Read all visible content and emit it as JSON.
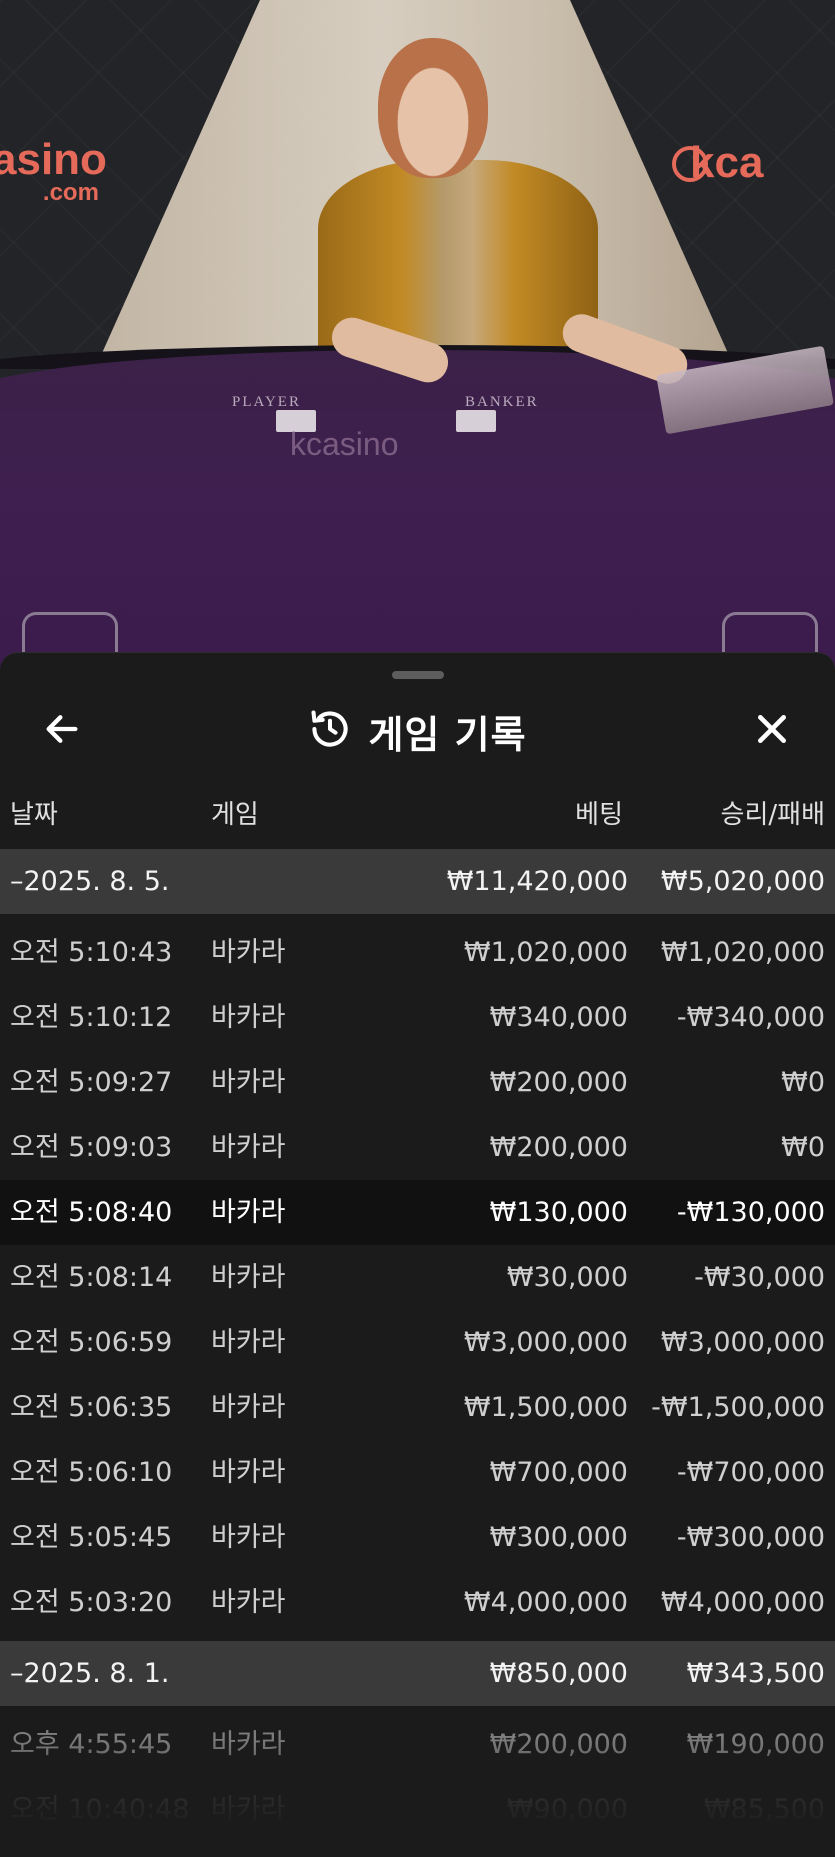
{
  "video": {
    "logo_left": "asino",
    "logo_left_sub": ".com",
    "logo_right": "kca",
    "table_player": "PLAYER",
    "table_banker": "BANKER",
    "table_logo": "kcasino"
  },
  "header": {
    "title": "게임 기록",
    "back_icon": "arrow-left-icon",
    "history_icon": "history-icon",
    "close_icon": "close-icon"
  },
  "columns": {
    "date": "날짜",
    "game": "게임",
    "bet": "베팅",
    "result": "승리/패배"
  },
  "groups": [
    {
      "date": "–2025. 8. 5.",
      "bet_total": "₩11,420,000",
      "result_total": "₩5,020,000",
      "rows": [
        {
          "time": "오전 5:10:43",
          "game": "바카라",
          "bet": "₩1,020,000",
          "result": "₩1,020,000"
        },
        {
          "time": "오전 5:10:12",
          "game": "바카라",
          "bet": "₩340,000",
          "result": "-₩340,000"
        },
        {
          "time": "오전 5:09:27",
          "game": "바카라",
          "bet": "₩200,000",
          "result": "₩0"
        },
        {
          "time": "오전 5:09:03",
          "game": "바카라",
          "bet": "₩200,000",
          "result": "₩0"
        },
        {
          "time": "오전 5:08:40",
          "game": "바카라",
          "bet": "₩130,000",
          "result": "-₩130,000"
        },
        {
          "time": "오전 5:08:14",
          "game": "바카라",
          "bet": "₩30,000",
          "result": "-₩30,000"
        },
        {
          "time": "오전 5:06:59",
          "game": "바카라",
          "bet": "₩3,000,000",
          "result": "₩3,000,000"
        },
        {
          "time": "오전 5:06:35",
          "game": "바카라",
          "bet": "₩1,500,000",
          "result": "-₩1,500,000"
        },
        {
          "time": "오전 5:06:10",
          "game": "바카라",
          "bet": "₩700,000",
          "result": "-₩700,000"
        },
        {
          "time": "오전 5:05:45",
          "game": "바카라",
          "bet": "₩300,000",
          "result": "-₩300,000"
        },
        {
          "time": "오전 5:03:20",
          "game": "바카라",
          "bet": "₩4,000,000",
          "result": "₩4,000,000"
        }
      ]
    },
    {
      "date": "–2025. 8. 1.",
      "bet_total": "₩850,000",
      "result_total": "₩343,500",
      "rows": [
        {
          "time": "오후 4:55:45",
          "game": "바카라",
          "bet": "₩200,000",
          "result": "₩190,000"
        },
        {
          "time": "오전 10:40:48",
          "game": "바카라",
          "bet": "₩90,000",
          "result": "₩85,500"
        }
      ]
    }
  ]
}
